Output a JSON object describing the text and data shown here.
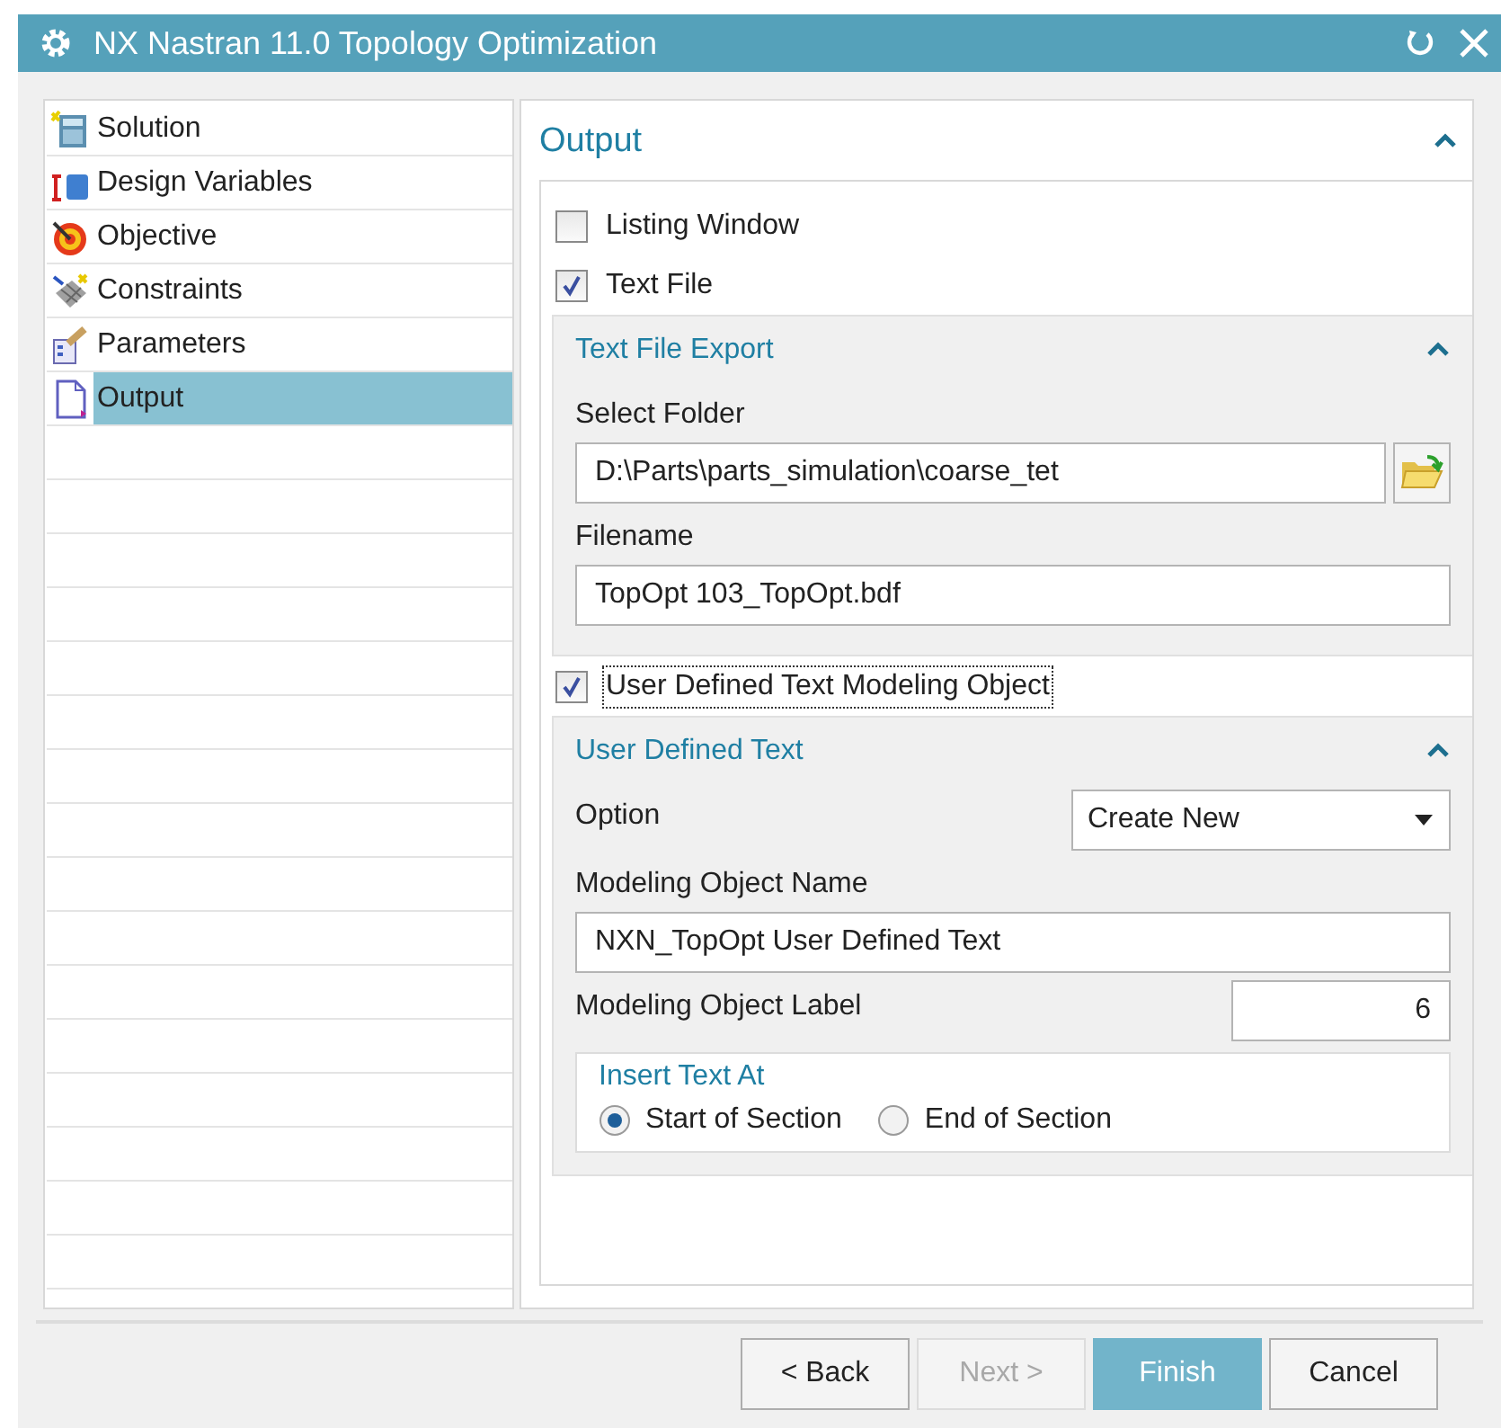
{
  "window": {
    "title": "NX Nastran 11.0 Topology Optimization"
  },
  "sidebar": {
    "items": [
      {
        "label": "Solution",
        "selected": false
      },
      {
        "label": "Design Variables",
        "selected": false
      },
      {
        "label": "Objective",
        "selected": false
      },
      {
        "label": "Constraints",
        "selected": false
      },
      {
        "label": "Parameters",
        "selected": false
      },
      {
        "label": "Output",
        "selected": true
      }
    ]
  },
  "panel": {
    "title": "Output",
    "expanded": true,
    "listing_window": {
      "label": "Listing Window",
      "checked": false
    },
    "text_file": {
      "label": "Text File",
      "checked": true
    },
    "text_file_export": {
      "title": "Text File Export",
      "expanded": true,
      "select_folder": {
        "label": "Select Folder",
        "value": "D:\\Parts\\parts_simulation\\coarse_tet"
      },
      "filename": {
        "label": "Filename",
        "value": "TopOpt 103_TopOpt.bdf"
      }
    },
    "user_defined_object": {
      "label": "User Defined Text Modeling Object",
      "checked": true,
      "focused": true
    },
    "user_defined_text": {
      "title": "User Defined Text",
      "expanded": true,
      "option": {
        "label": "Option",
        "value": "Create New"
      },
      "object_name": {
        "label": "Modeling Object Name",
        "value": "NXN_TopOpt User Defined Text"
      },
      "object_label": {
        "label": "Modeling Object Label",
        "value": "6"
      },
      "insert_text_at": {
        "title": "Insert Text At",
        "options": [
          {
            "label": "Start of Section",
            "selected": true
          },
          {
            "label": "End of Section",
            "selected": false
          }
        ]
      }
    }
  },
  "buttons": [
    {
      "label": "< Back",
      "kind": "normal",
      "disabled": false
    },
    {
      "label": "Next >",
      "kind": "normal",
      "disabled": true
    },
    {
      "label": "Finish",
      "kind": "primary",
      "disabled": false
    },
    {
      "label": "Cancel",
      "kind": "normal",
      "disabled": false
    }
  ]
}
